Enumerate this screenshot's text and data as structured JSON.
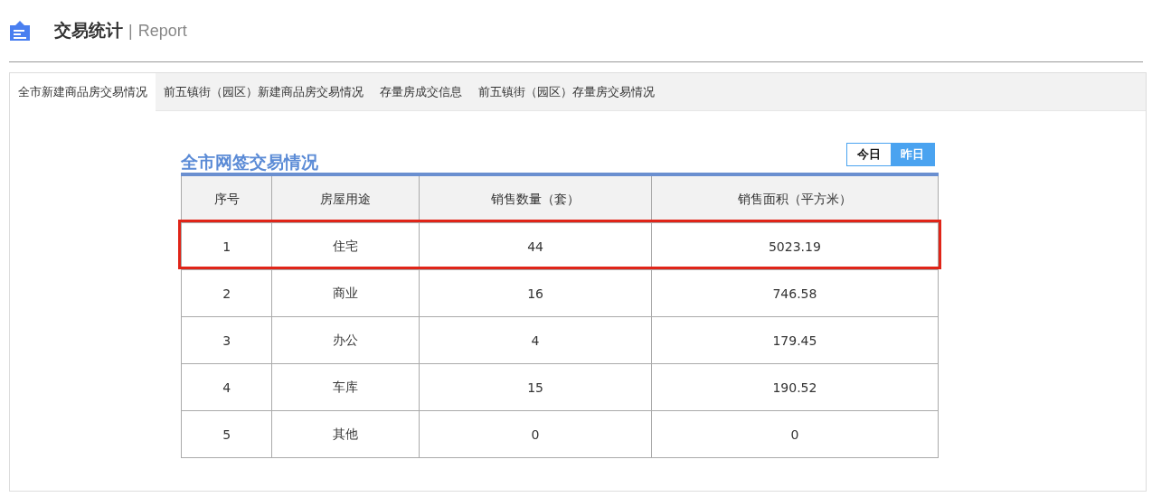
{
  "header": {
    "title": "交易统计",
    "separator": "|",
    "subtitle": "Report"
  },
  "tabs": [
    {
      "label": "全市新建商品房交易情况",
      "selected": true
    },
    {
      "label": "前五镇街（园区）新建商品房交易情况",
      "selected": false
    },
    {
      "label": "存量房成交信息",
      "selected": false
    },
    {
      "label": "前五镇街（园区）存量房交易情况",
      "selected": false
    }
  ],
  "section": {
    "title": "全市网签交易情况",
    "day_toggle": [
      {
        "label": "今日",
        "selected": false
      },
      {
        "label": "昨日",
        "selected": true
      }
    ],
    "table": {
      "columns": [
        "序号",
        "房屋用途",
        "销售数量（套）",
        "销售面积（平方米）"
      ],
      "rows": [
        {
          "cells": [
            "1",
            "住宅",
            "44",
            "5023.19"
          ],
          "highlighted": true
        },
        {
          "cells": [
            "2",
            "商业",
            "16",
            "746.58"
          ],
          "highlighted": false
        },
        {
          "cells": [
            "3",
            "办公",
            "4",
            "179.45"
          ],
          "highlighted": false
        },
        {
          "cells": [
            "4",
            "车库",
            "15",
            "190.52"
          ],
          "highlighted": false
        },
        {
          "cells": [
            "5",
            "其他",
            "0",
            "0"
          ],
          "highlighted": false
        }
      ]
    }
  }
}
